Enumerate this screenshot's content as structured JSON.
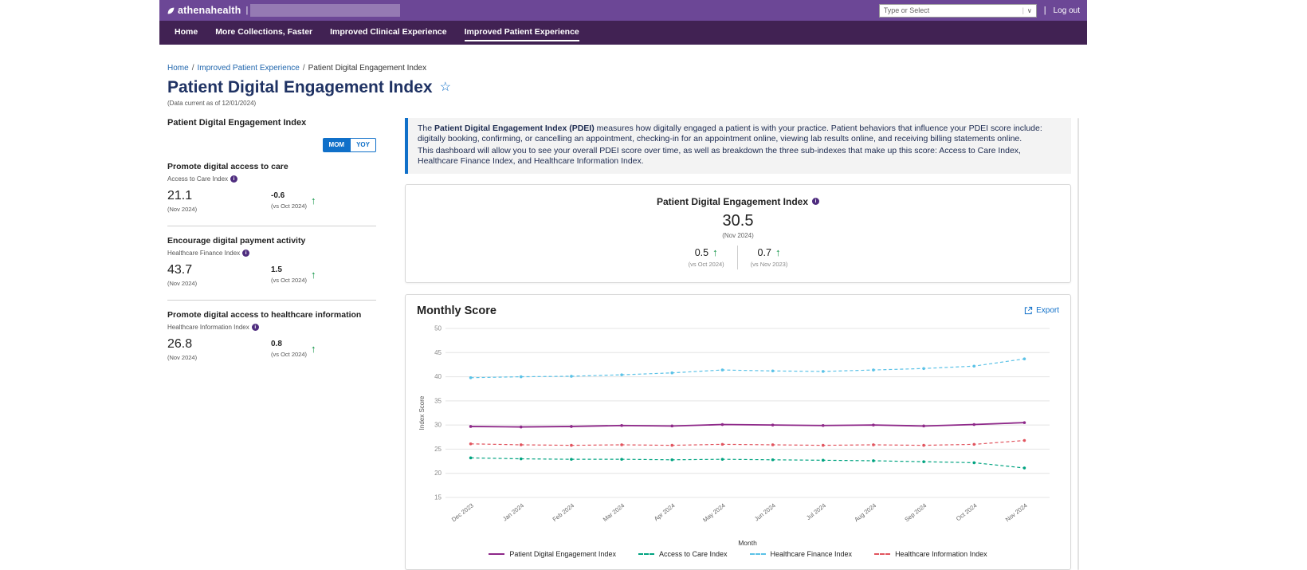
{
  "topbar": {
    "brand": "athenahealth",
    "search_value": "",
    "filter_placeholder": "Type or Select",
    "logout_label": "Log out"
  },
  "nav": {
    "items": [
      {
        "label": "Home",
        "active": false
      },
      {
        "label": "More Collections, Faster",
        "active": false
      },
      {
        "label": "Improved Clinical Experience",
        "active": false
      },
      {
        "label": "Improved Patient Experience",
        "active": true
      }
    ]
  },
  "breadcrumb": {
    "items": [
      "Home",
      "Improved Patient Experience",
      "Patient Digital Engagement Index"
    ]
  },
  "page": {
    "title": "Patient Digital Engagement Index",
    "data_current_note": "(Data current as of 12/01/2024)"
  },
  "sidebar": {
    "title": "Patient Digital Engagement Index",
    "toggle": {
      "mom": "MOM",
      "yoy": "YOY",
      "active": "MOM"
    },
    "metrics": [
      {
        "goal": "Promote digital access to care",
        "index_name": "Access to Care Index",
        "value": "21.1",
        "value_period": "(Nov 2024)",
        "delta": "-0.6",
        "delta_period": "(vs Oct 2024)",
        "trend": "up"
      },
      {
        "goal": "Encourage digital payment activity",
        "index_name": "Healthcare Finance Index",
        "value": "43.7",
        "value_period": "(Nov 2024)",
        "delta": "1.5",
        "delta_period": "(vs Oct 2024)",
        "trend": "up"
      },
      {
        "goal": "Promote digital access to healthcare information",
        "index_name": "Healthcare Information Index",
        "value": "26.8",
        "value_period": "(Nov 2024)",
        "delta": "0.8",
        "delta_period": "(vs Oct 2024)",
        "trend": "up"
      }
    ]
  },
  "info_banner": {
    "p1_prefix": "The ",
    "p1_bold": "Patient Digital Engagement Index (PDEI)",
    "p1_rest": " measures how digitally engaged a patient is with your practice. Patient behaviors that influence your PDEI score include: digitally booking, confirming, or cancelling an appointment, checking-in for an appointment online, viewing lab results online, and receiving billing statements online.",
    "p2": "This dashboard will allow you to see your overall PDEI score over time, as well as breakdown the three sub-indexes that make up this score: Access to Care Index, Healthcare Finance Index, and Healthcare Information Index."
  },
  "score_card": {
    "title": "Patient Digital Engagement Index",
    "value": "30.5",
    "period": "(Nov 2024)",
    "deltas": [
      {
        "value": "0.5",
        "trend": "up",
        "period": "(vs Oct 2024)"
      },
      {
        "value": "0.7",
        "trend": "up",
        "period": "(vs Nov 2023)"
      }
    ]
  },
  "chart_card": {
    "title": "Monthly Score",
    "export_label": "Export"
  },
  "chart_data": {
    "type": "line",
    "title": "Monthly Score",
    "xlabel": "Month",
    "ylabel": "Index Score",
    "ylim": [
      15,
      50
    ],
    "ytick_step": 5,
    "grid": true,
    "legend_position": "bottom",
    "categories": [
      "Dec 2023",
      "Jan 2024",
      "Feb 2024",
      "Mar 2024",
      "Apr 2024",
      "May 2024",
      "Jun 2024",
      "Jul 2024",
      "Aug 2024",
      "Sep 2024",
      "Oct 2024",
      "Nov 2024"
    ],
    "series": [
      {
        "name": "Patient Digital Engagement Index",
        "color": "#8e2889",
        "dash": false,
        "values": [
          29.7,
          29.6,
          29.7,
          29.9,
          29.8,
          30.1,
          30.0,
          29.9,
          30.0,
          29.8,
          30.1,
          30.5
        ]
      },
      {
        "name": "Access to Care Index",
        "color": "#00a380",
        "dash": true,
        "values": [
          23.2,
          23.0,
          22.9,
          22.9,
          22.8,
          22.9,
          22.8,
          22.7,
          22.6,
          22.4,
          22.2,
          21.1
        ]
      },
      {
        "name": "Healthcare Finance Index",
        "color": "#5bc2e7",
        "dash": true,
        "values": [
          39.8,
          40.0,
          40.1,
          40.4,
          40.8,
          41.4,
          41.2,
          41.1,
          41.4,
          41.7,
          42.2,
          43.7
        ]
      },
      {
        "name": "Healthcare Information Index",
        "color": "#e1545e",
        "dash": true,
        "values": [
          26.1,
          25.9,
          25.8,
          25.9,
          25.8,
          26.0,
          25.9,
          25.8,
          25.9,
          25.8,
          26.0,
          26.8
        ]
      }
    ]
  },
  "colors": {
    "topbar_purple": "#6c4796",
    "nav_purple": "#412253",
    "accent_blue": "#1070c9",
    "link_blue": "#2066ad",
    "title_navy": "#1f3263",
    "positive_green": "#0a9140"
  }
}
